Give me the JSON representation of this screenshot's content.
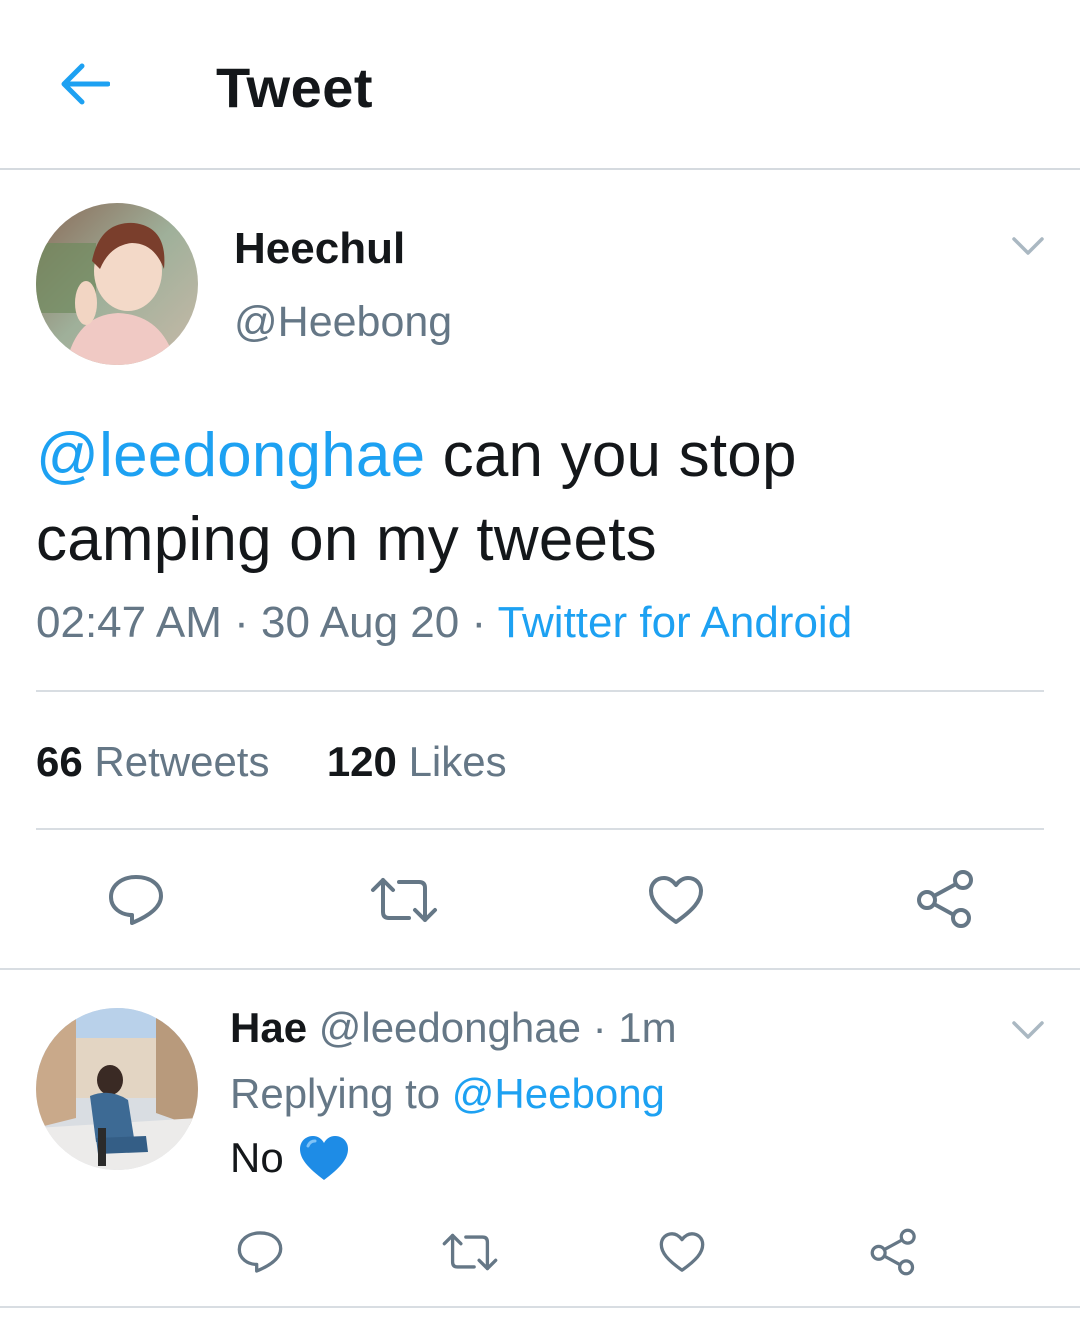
{
  "header": {
    "title": "Tweet",
    "back_icon": "arrow-left-icon"
  },
  "tweet": {
    "author_name": "Heechul",
    "author_handle": "@Heebong",
    "text_mention": "@leedonghae",
    "text_rest": " can you stop camping on my tweets",
    "time": "02:47 AM",
    "date": "30 Aug 20",
    "source": "Twitter for Android",
    "retweets_count": "66",
    "retweets_label": "Retweets",
    "likes_count": "120",
    "likes_label": "Likes"
  },
  "reply": {
    "author_name": "Hae",
    "author_handle": "@leedonghae",
    "age": "1m",
    "replying_to_label": "Replying to",
    "replying_to_handle": "@Heebong",
    "text": "No",
    "emoji_icon": "blue-heart-icon"
  },
  "colors": {
    "accent": "#1da1f2",
    "text_primary": "#14171a",
    "text_secondary": "#657786",
    "divider": "#d8dde2"
  }
}
